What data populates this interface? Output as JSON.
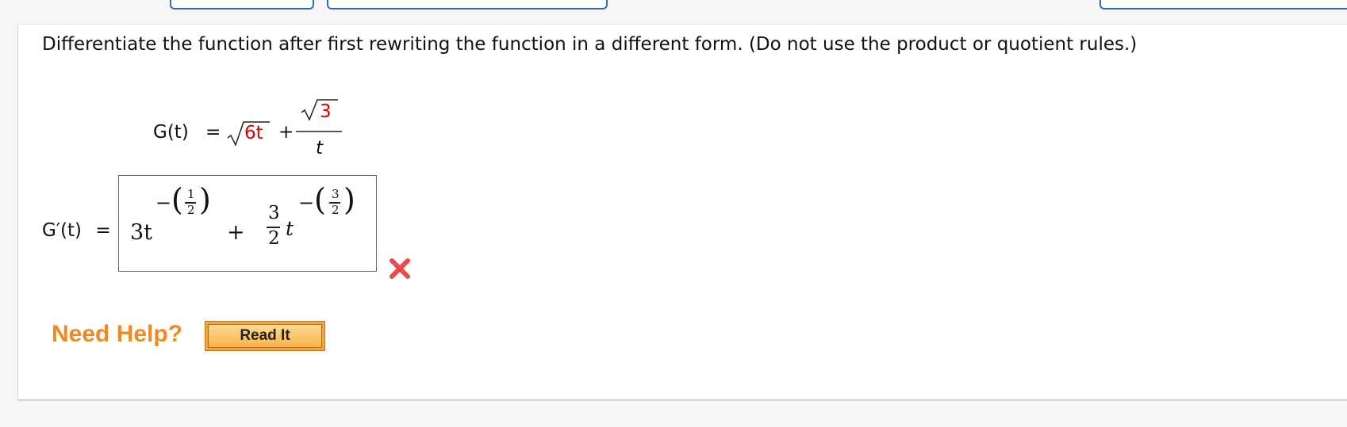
{
  "question": {
    "prompt": "Differentiate the function after first rewriting the function in a different form. (Do not use the product or quotient rules.)"
  },
  "function": {
    "lhs": "G(t)",
    "equals": "=",
    "radicand_1": "6t",
    "plus": "+",
    "numerator_radicand": "3",
    "denominator": "t"
  },
  "answer": {
    "label": "G′(t)",
    "equals": "=",
    "term1_coef": "3t",
    "term1_exp_sign": "−",
    "term1_exp_num": "1",
    "term1_exp_den": "2",
    "plus": "+",
    "term2_coef_num": "3",
    "term2_coef_den": "2",
    "term2_var": "t",
    "term2_exp_sign": "−",
    "term2_exp_num": "3",
    "term2_exp_den": "2",
    "status": "incorrect"
  },
  "help": {
    "label": "Need Help?",
    "read_it_button": "Read It"
  },
  "colors": {
    "accent_red": "#d80000",
    "help_orange": "#f08a1c",
    "tab_border": "#2f6db0",
    "wrong_mark": "#e84b4b"
  }
}
